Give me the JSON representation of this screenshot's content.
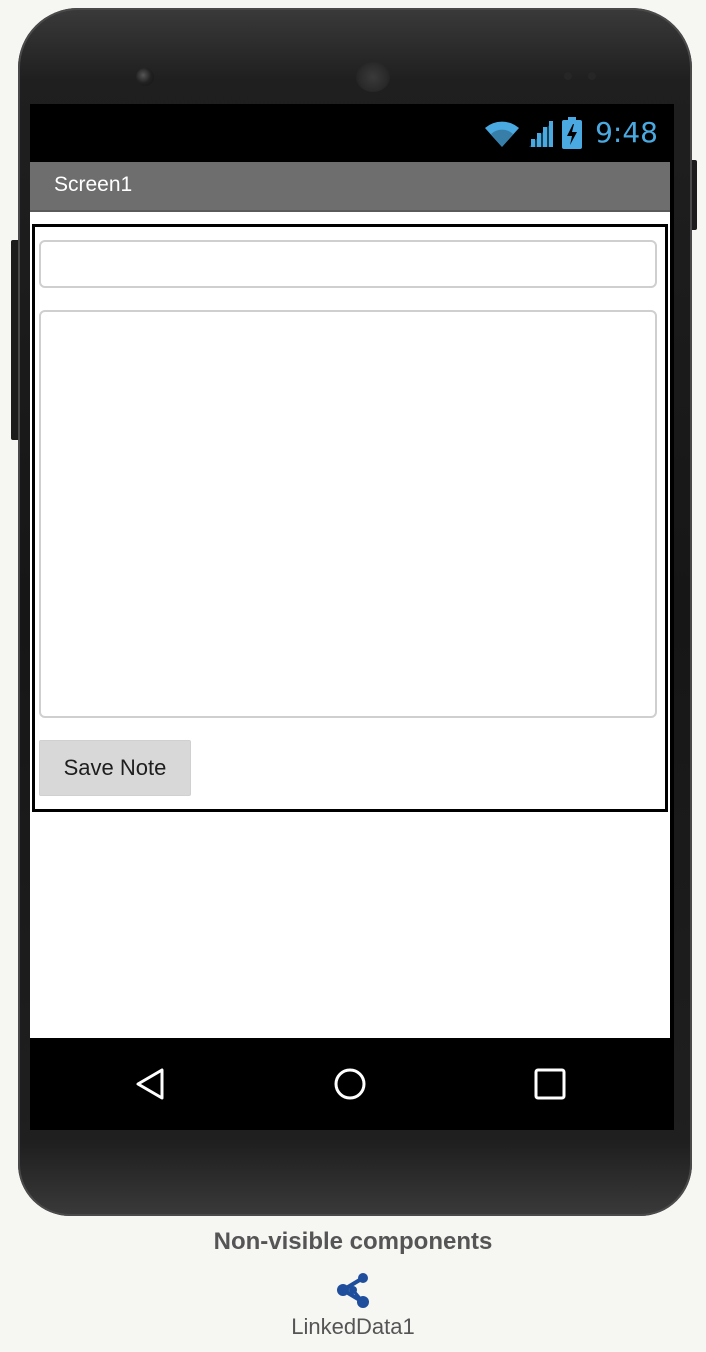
{
  "status_bar": {
    "time": "9:48",
    "icons": [
      "wifi-icon",
      "signal-icon",
      "battery-charging-icon"
    ],
    "accent_color": "#4aa9e0"
  },
  "screen": {
    "title": "Screen1"
  },
  "form": {
    "title_input": {
      "value": "",
      "placeholder": ""
    },
    "note_input": {
      "value": "",
      "placeholder": ""
    },
    "save_button_label": "Save Note"
  },
  "nav_bar": {
    "icons": [
      "back-icon",
      "home-icon",
      "recents-icon"
    ]
  },
  "non_visible": {
    "heading": "Non-visible components",
    "items": [
      {
        "label": "LinkedData1",
        "icon": "linked-data-icon",
        "color": "#1f4e9c"
      }
    ]
  }
}
